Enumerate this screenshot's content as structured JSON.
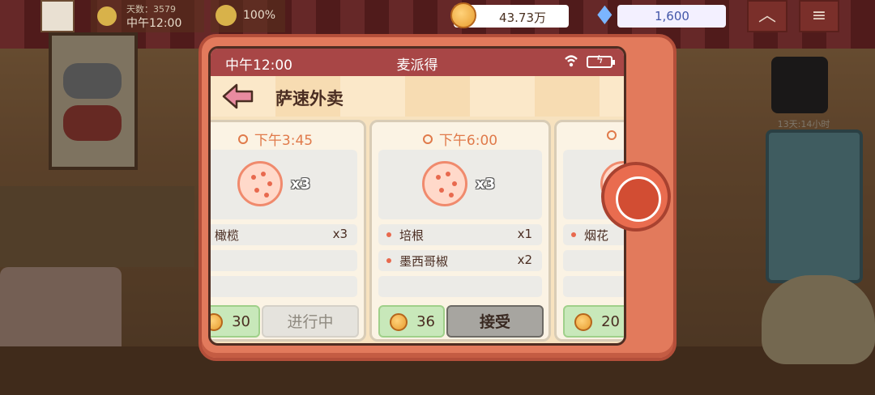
{
  "hud": {
    "day_label": "天数：3579",
    "time_label": "中午12:00",
    "mood": "100%",
    "coins": "43.73万",
    "gems": "1,600",
    "up_icon": "chevron-up-icon",
    "menu_icon": "hamburger-menu-icon",
    "spy_timer": "13天:14小时"
  },
  "phone": {
    "status_time": "中午12:00",
    "app_name": "麦派得",
    "wifi_icon": "wifi-icon",
    "battery_icon": "battery-charging-icon",
    "page_title": "萨速外卖",
    "back_icon": "back-arrow-icon"
  },
  "orders": [
    {
      "time": "下午3:45",
      "qty": "x3",
      "ingredients": [
        {
          "name": "橄榄",
          "count": "x3"
        }
      ],
      "reward": "30",
      "action": "进行中"
    },
    {
      "time": "下午6:00",
      "qty": "x3",
      "ingredients": [
        {
          "name": "培根",
          "count": "x1"
        },
        {
          "name": "墨西哥椒",
          "count": "x2"
        }
      ],
      "reward": "36",
      "action": "接受"
    },
    {
      "time": "",
      "qty": "",
      "ingredients": [
        {
          "name": "烟花",
          "count": ""
        }
      ],
      "reward": "20",
      "action": ""
    }
  ],
  "colors": {
    "device": "#e27a5c",
    "status_bar": "#a84646",
    "accent_time": "#e07a4a",
    "reward_bg": "#c8e8ba"
  }
}
